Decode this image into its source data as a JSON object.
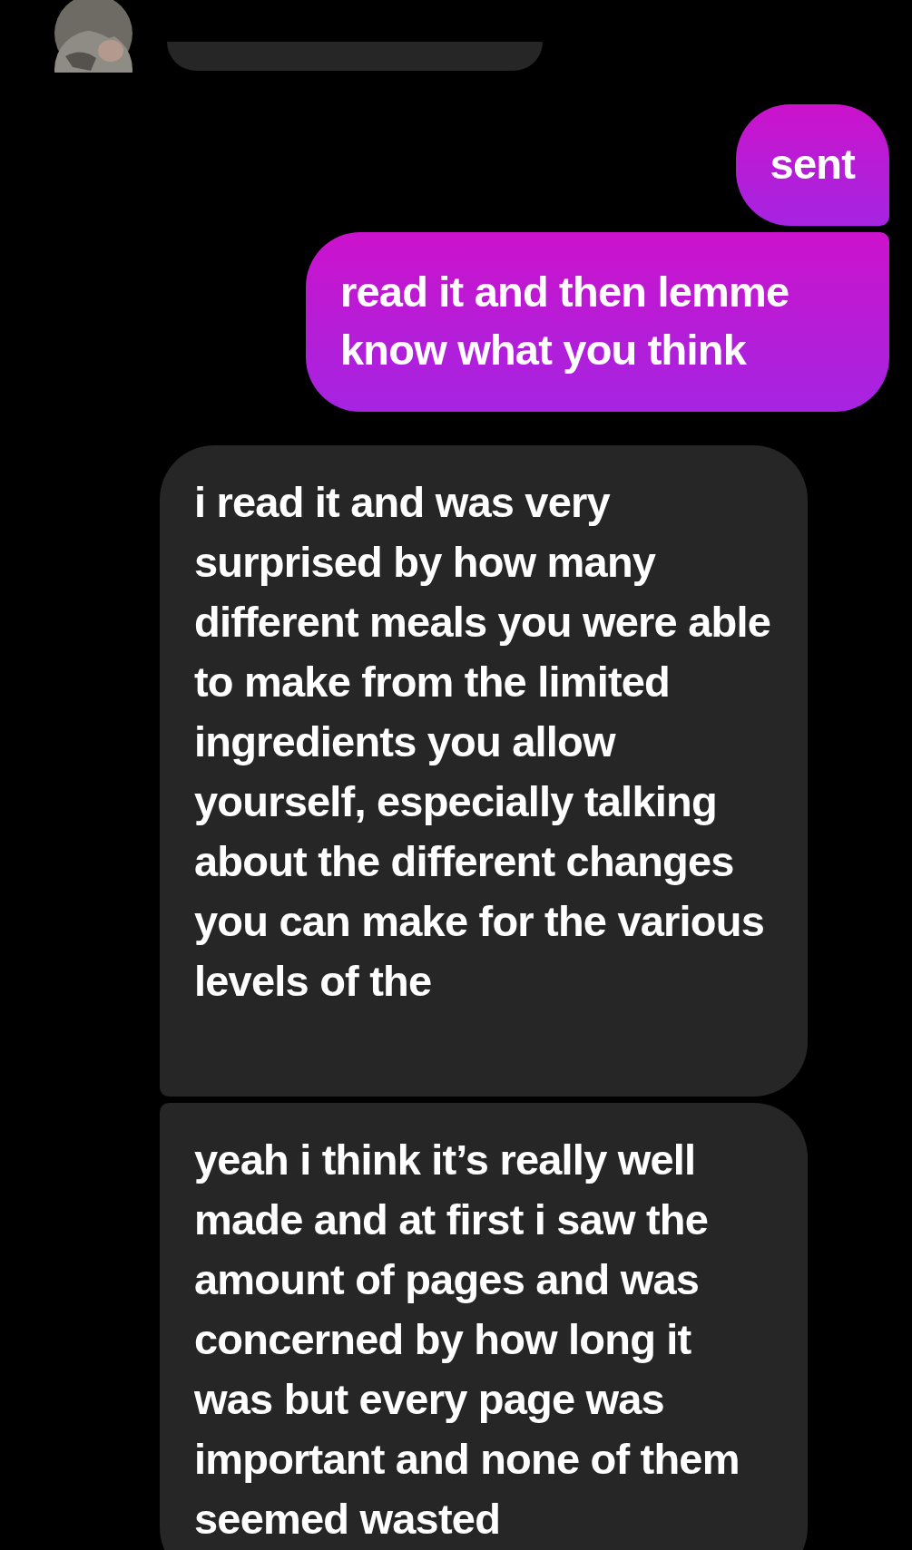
{
  "messages": [
    {
      "kind": "partial"
    },
    {
      "kind": "sent",
      "text": "sent"
    },
    {
      "kind": "sent",
      "text": "read it and then lemme know what you think"
    },
    {
      "kind": "received",
      "text": "i read it and was very surprised by how many different meals you were able to make from the limited ingredients you allow yourself, especially talking about the different changes you can make for the various levels of the"
    },
    {
      "kind": "received",
      "text": "yeah i think it’s really well made and at first i saw the amount of pages and was concerned by how long it was but every page was important and none of them seemed wasted"
    }
  ]
}
